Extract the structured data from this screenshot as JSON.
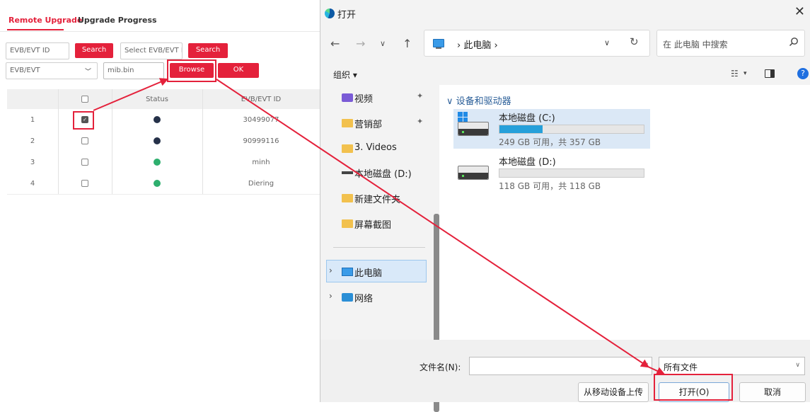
{
  "web": {
    "tabs": [
      {
        "label": "Remote Upgrade",
        "active": true
      },
      {
        "label": "Upgrade Progress",
        "active": false
      }
    ],
    "filter": {
      "evb_id_placeholder": "EVB/EVT ID",
      "search_label": "Search",
      "select_placeholder": "Select EVB/EVT II",
      "search2_label": "Search",
      "type_select_value": "EVB/EVT",
      "file_value": "mib.bin",
      "browse_label": "Browse",
      "ok_label": "OK"
    },
    "table": {
      "columns": [
        "",
        "",
        "Status",
        "EVB/EVT ID"
      ],
      "rows": [
        {
          "index": "1",
          "checked": true,
          "status_color": "#253149",
          "id": "30499077"
        },
        {
          "index": "2",
          "checked": false,
          "status_color": "#253149",
          "id": "90999116"
        },
        {
          "index": "3",
          "checked": false,
          "status_color": "#2eaf6e",
          "id": "minh"
        },
        {
          "index": "4",
          "checked": false,
          "status_color": "#2eaf6e",
          "id": "Diering"
        }
      ]
    },
    "accent": "#e4213b"
  },
  "dialog": {
    "title": "打开",
    "close_icon": "close-icon",
    "address": "› 此电脑 ›",
    "search_placeholder": "在 此电脑 中搜索",
    "organize_label": "组织 ▾",
    "view_dropdown": "▾",
    "nav_items": [
      {
        "label": "视频",
        "icon": "videos-icon",
        "pinned": true
      },
      {
        "label": "营销部",
        "icon": "folder-icon",
        "pinned": true
      },
      {
        "label": "3. Videos",
        "icon": "folder-icon",
        "pinned": false
      },
      {
        "label": "本地磁盘 (D:)",
        "icon": "drive-icon",
        "pinned": false
      },
      {
        "label": "新建文件夹",
        "icon": "folder-icon",
        "pinned": false
      },
      {
        "label": "屏幕截图",
        "icon": "folder-icon",
        "pinned": false
      }
    ],
    "tree_items": [
      {
        "label": "此电脑",
        "icon": "this-pc-icon",
        "selected": true
      },
      {
        "label": "网络",
        "icon": "network-icon",
        "selected": false
      }
    ],
    "group_title": "设备和驱动器",
    "drives": [
      {
        "name": "本地磁盘 (C:)",
        "info": "249 GB 可用，共 357 GB",
        "used_fraction": 0.3,
        "selected": true
      },
      {
        "name": "本地磁盘 (D:)",
        "info": "118 GB 可用，共 118 GB",
        "used_fraction": 0.0,
        "selected": false
      }
    ],
    "filename_label": "文件名(N):",
    "filename_value": "",
    "filetype_value": "所有文件",
    "upload_mobile_label": "从移动设备上传",
    "open_label": "打开(O)",
    "cancel_label": "取消"
  }
}
